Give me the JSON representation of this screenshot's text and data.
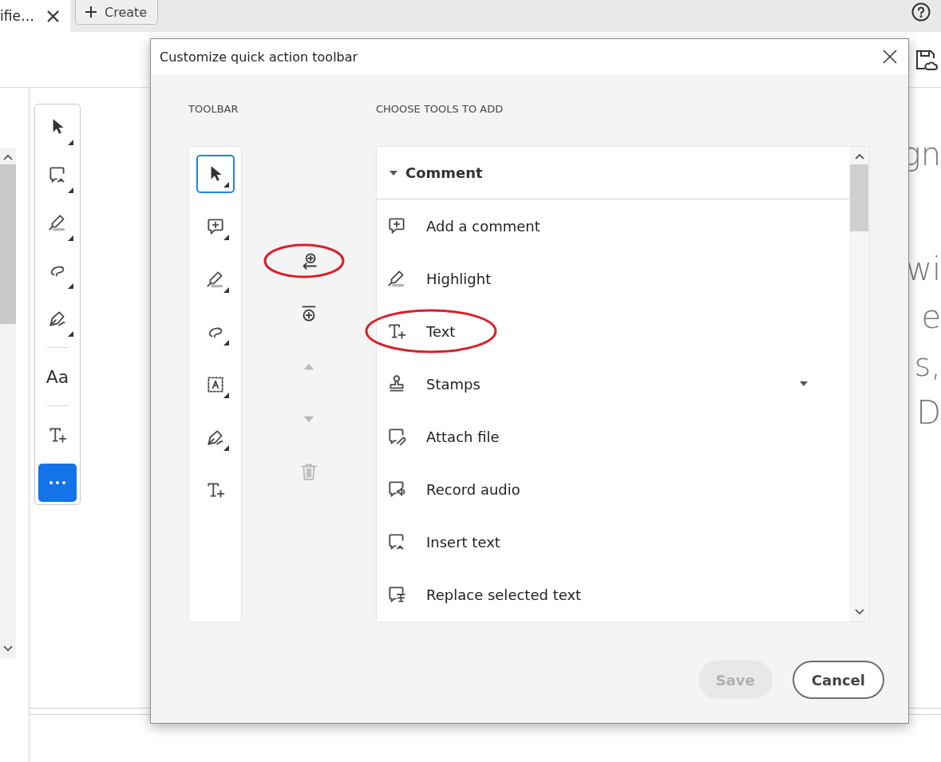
{
  "tab_bar": {
    "tabs": [
      {
        "title": "ifie…",
        "selected": true
      }
    ],
    "create_button": "Create"
  },
  "quick_toolbar": {
    "tools": [
      {
        "kind": "select",
        "flyout": true
      },
      {
        "kind": "insert-text",
        "flyout": true
      },
      {
        "kind": "highlight",
        "flyout": true
      },
      {
        "kind": "draw",
        "flyout": true
      },
      {
        "kind": "sign",
        "flyout": true
      },
      {
        "kind": "divider"
      },
      {
        "kind": "font",
        "label": "Aa"
      },
      {
        "kind": "divider"
      },
      {
        "kind": "add-text",
        "flyout": false
      },
      {
        "kind": "more"
      }
    ]
  },
  "document": {
    "paragraphs": [
      {
        "lines": [
          {
            "text": "gn"
          }
        ]
      },
      {
        "lines": [
          {
            "text": "wi"
          },
          {
            "text": "e"
          },
          {
            "text": "s,"
          },
          {
            "text": "D"
          }
        ]
      }
    ]
  },
  "dialog": {
    "title": "Customize quick action toolbar",
    "toolbar_label": "TOOLBAR",
    "tools_label": "CHOOSE TOOLS TO ADD",
    "toolbar_items": [
      {
        "kind": "select",
        "selected": true,
        "flyout": true
      },
      {
        "kind": "add-comment",
        "selected": false,
        "flyout": true
      },
      {
        "kind": "highlight",
        "selected": false,
        "flyout": true
      },
      {
        "kind": "draw",
        "selected": false,
        "flyout": true
      },
      {
        "kind": "text-box",
        "selected": false,
        "flyout": true
      },
      {
        "kind": "sign",
        "selected": false,
        "flyout": true
      },
      {
        "kind": "add-text",
        "selected": false,
        "flyout": false
      }
    ],
    "actions": [
      {
        "kind": "add",
        "disabled": false,
        "circled": true
      },
      {
        "kind": "add-divider",
        "disabled": false,
        "circled": false
      },
      {
        "kind": "move-up",
        "disabled": true,
        "circled": false
      },
      {
        "kind": "move-down",
        "disabled": true,
        "circled": false
      },
      {
        "kind": "delete",
        "disabled": true,
        "circled": false
      }
    ],
    "group": {
      "title": "Comment",
      "expanded": true,
      "tools": [
        {
          "kind": "add-comment",
          "label": "Add a comment",
          "circled": false,
          "has_menu": false
        },
        {
          "kind": "highlight",
          "label": "Highlight",
          "circled": false,
          "has_menu": false
        },
        {
          "kind": "add-text",
          "label": "Text",
          "circled": true,
          "has_menu": false
        },
        {
          "kind": "stamp",
          "label": "Stamps",
          "circled": false,
          "has_menu": true
        },
        {
          "kind": "attach",
          "label": "Attach file",
          "circled": false,
          "has_menu": false
        },
        {
          "kind": "audio",
          "label": "Record audio",
          "circled": false,
          "has_menu": false
        },
        {
          "kind": "insert-text",
          "label": "Insert text",
          "circled": false,
          "has_menu": false
        },
        {
          "kind": "replace",
          "label": "Replace selected text",
          "circled": false,
          "has_menu": false
        }
      ]
    },
    "buttons": [
      {
        "label": "Save",
        "disabled": true
      },
      {
        "label": "Cancel",
        "disabled": false
      }
    ]
  }
}
